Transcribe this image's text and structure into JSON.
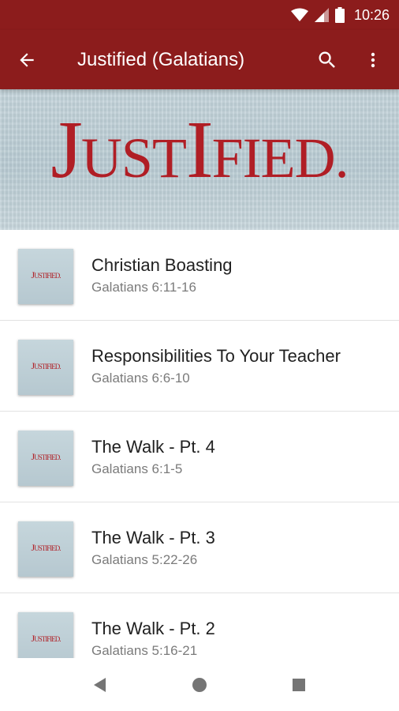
{
  "status": {
    "time": "10:26"
  },
  "appbar": {
    "title": "Justified (Galatians)",
    "icons": [
      "back-arrow-icon",
      "search-icon",
      "overflow-menu-icon"
    ]
  },
  "banner": {
    "logo_big1": "J",
    "logo_small1": "UST",
    "logo_big2": "I",
    "logo_small2": "FIED."
  },
  "thumb_logo": {
    "a": "J",
    "b": "UST",
    "c": "IFIED."
  },
  "list": {
    "items": [
      {
        "title": "Christian Boasting",
        "subtitle": "Galatians 6:11-16"
      },
      {
        "title": "Responsibilities To Your Teacher",
        "subtitle": "Galatians 6:6-10"
      },
      {
        "title": "The Walk - Pt. 4",
        "subtitle": "Galatians 6:1-5"
      },
      {
        "title": "The Walk - Pt. 3",
        "subtitle": "Galatians 5:22-26"
      },
      {
        "title": "The Walk - Pt. 2",
        "subtitle": "Galatians 5:16-21"
      }
    ]
  },
  "colors": {
    "primary": "#8c1c1c",
    "logo_red": "#b01e25",
    "banner_bg": "#c3d3da"
  },
  "navbar": {
    "icons": [
      "back-triangle-icon",
      "home-circle-icon",
      "recents-square-icon"
    ]
  }
}
